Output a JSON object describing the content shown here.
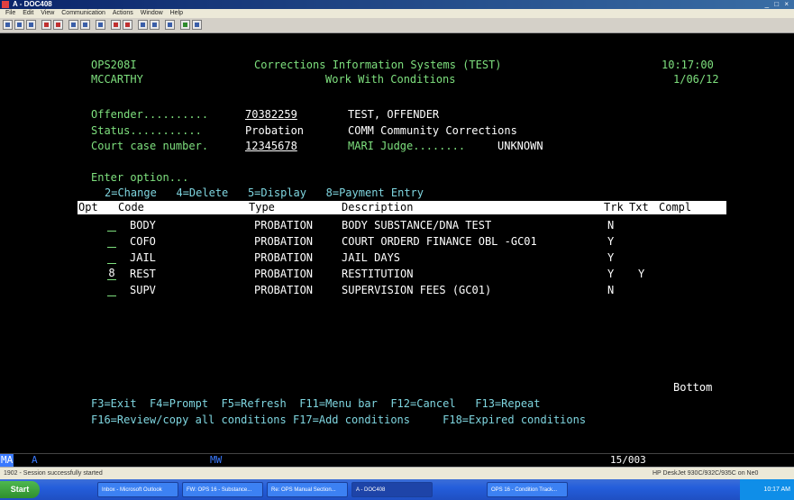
{
  "window": {
    "title": "A - DOC408",
    "controls": "_ □ ×"
  },
  "menu": [
    "File",
    "Edit",
    "View",
    "Communication",
    "Actions",
    "Window",
    "Help"
  ],
  "screen": {
    "program": "OPS208I",
    "user": "MCCARTHY",
    "system_title": "Corrections Information Systems (TEST)",
    "screen_title": "Work With Conditions",
    "time": "10:17:00",
    "date": "1/06/12",
    "offender_label": "Offender..........",
    "offender_value": "70382259",
    "offender_name": "TEST, OFFENDER",
    "status_label": "Status...........",
    "status_value": "Probation",
    "status_desc": "COMM Community Corrections",
    "case_label": "Court case number.",
    "case_value": "12345678",
    "judge_label": "MARI Judge........",
    "judge_value": "UNKNOWN",
    "enter_option": "Enter option...",
    "options": "2=Change   4=Delete   5=Display   8=Payment Entry",
    "columns": {
      "opt": "Opt",
      "code": "Code",
      "type": "Type",
      "description": "Description",
      "trk": "Trk",
      "txt": "Txt",
      "compl": "Compl"
    },
    "rows": [
      {
        "opt": "",
        "code": "BODY",
        "type": "PROBATION",
        "description": "BODY SUBSTANCE/DNA TEST",
        "trk": "N",
        "txt": ""
      },
      {
        "opt": "",
        "code": "COFO",
        "type": "PROBATION",
        "description": "COURT ORDERD FINANCE OBL -GC01",
        "trk": "Y",
        "txt": ""
      },
      {
        "opt": "",
        "code": "JAIL",
        "type": "PROBATION",
        "description": "JAIL DAYS",
        "trk": "Y",
        "txt": ""
      },
      {
        "opt": "8",
        "code": "REST",
        "type": "PROBATION",
        "description": "RESTITUTION",
        "trk": "Y",
        "txt": "Y"
      },
      {
        "opt": "",
        "code": "SUPV",
        "type": "PROBATION",
        "description": "SUPERVISION FEES (GC01)",
        "trk": "N",
        "txt": ""
      }
    ],
    "bottom": "Bottom",
    "fkeys_line1": "F3=Exit  F4=Prompt  F5=Refresh  F11=Menu bar  F12=Cancel   F13=Repeat",
    "fkeys_line2": "F16=Review/copy all conditions F17=Add conditions     F18=Expired conditions"
  },
  "oia": {
    "ma": "MA",
    "mode": "A",
    "mw": "MW",
    "cursor": "15/003"
  },
  "statusbar": {
    "message": "1902 - Session successfully started",
    "printer": "HP DeskJet 930C/932C/935C on Ne0"
  },
  "taskbar": {
    "start": "Start",
    "tasks": [
      "Inbox - Microsoft Outlook",
      "FW: OPS 16 - Substance...",
      "Re: OPS Manual Section...",
      "A - DOC408",
      "OPS 16 - Condition Track..."
    ],
    "clock": "10:17 AM"
  },
  "colors": {
    "screen_bg": "#000000",
    "green_text": "#7ee07e",
    "white_text": "#ffffff",
    "cyan_text": "#7fd6e0",
    "oia_blue": "#3a7aff"
  }
}
